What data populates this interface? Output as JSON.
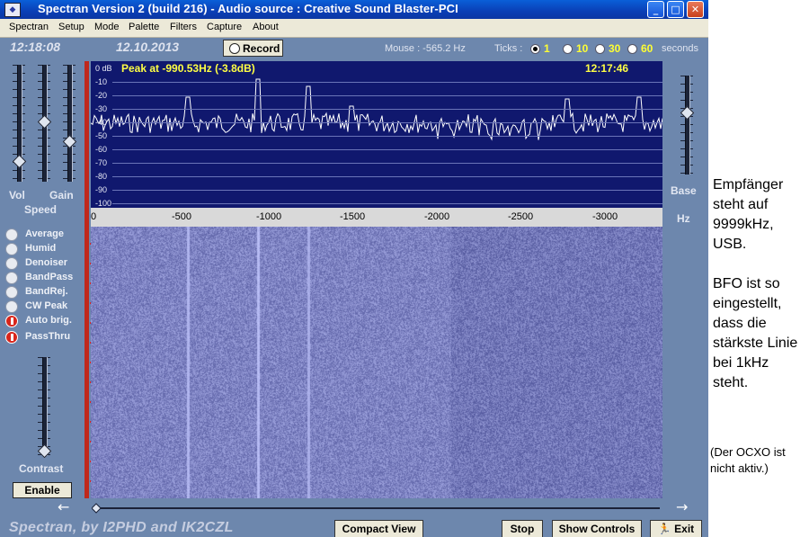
{
  "window": {
    "title": "Spectran Version 2 (build 216) - Audio source  :  Creative Sound Blaster-PCI",
    "app_icon": "spectran-icon",
    "controls": [
      "_",
      "□",
      "✕"
    ]
  },
  "menu": [
    "Spectran",
    "Setup",
    "Mode",
    "Palette",
    "Filters",
    "Capture",
    "About"
  ],
  "status": {
    "time": "12:18:08",
    "date": "12.10.2013",
    "record_label": "Record",
    "mouse": "Mouse :  -565.2 Hz",
    "ticks_label": "Ticks :",
    "tick_options": [
      "1",
      "10",
      "30",
      "60"
    ],
    "tick_selected": "1",
    "seconds_label": "seconds"
  },
  "left_panel": {
    "vol_label": "Vol",
    "gain_label": "Gain",
    "speed_label": "Speed",
    "options": [
      {
        "label": "Average",
        "on": false
      },
      {
        "label": "Humid",
        "on": false
      },
      {
        "label": "Denoiser",
        "on": false
      },
      {
        "label": "BandPass",
        "on": false
      },
      {
        "label": "BandRej.",
        "on": false
      },
      {
        "label": "CW Peak",
        "on": false
      },
      {
        "label": "Auto brig.",
        "on": true
      },
      {
        "label": "PassThru",
        "on": true
      }
    ],
    "contrast_label": "Contrast",
    "enable_label": "Enable"
  },
  "spectrum": {
    "peak_text": "Peak at  -990.53Hz (-3.8dB)",
    "peak_time": "12:17:46",
    "db_labels": [
      "0 dB",
      "-10",
      "-20",
      "-30",
      "-40",
      "-50",
      "-60",
      "-70",
      "-80",
      "-90",
      "-100"
    ]
  },
  "freq_axis": {
    "labels": [
      "0",
      "-500",
      "-1000",
      "-1500",
      "-2000",
      "-2500",
      "-3000"
    ]
  },
  "right_panel": {
    "base_label": "Base",
    "hz_label": "Hz"
  },
  "bottom": {
    "brand": "Spectran, by I2PHD and IK2CZL",
    "compact_view": "Compact View",
    "stop": "Stop",
    "show_controls": "Show Controls",
    "exit": "Exit"
  },
  "note": {
    "line1": "Empfänger steht auf 9999kHz, USB.",
    "line2": "BFO ist so eingestellt, dass die stärkste Linie bei 1kHz steht.",
    "line3": "(Der OCXO ist nicht aktiv.)"
  },
  "colors": {
    "panel": "#6d87ad",
    "spectrum_bg": "#10186e",
    "peak_text": "#ffff44",
    "waterfall": "#3a4aa8"
  }
}
